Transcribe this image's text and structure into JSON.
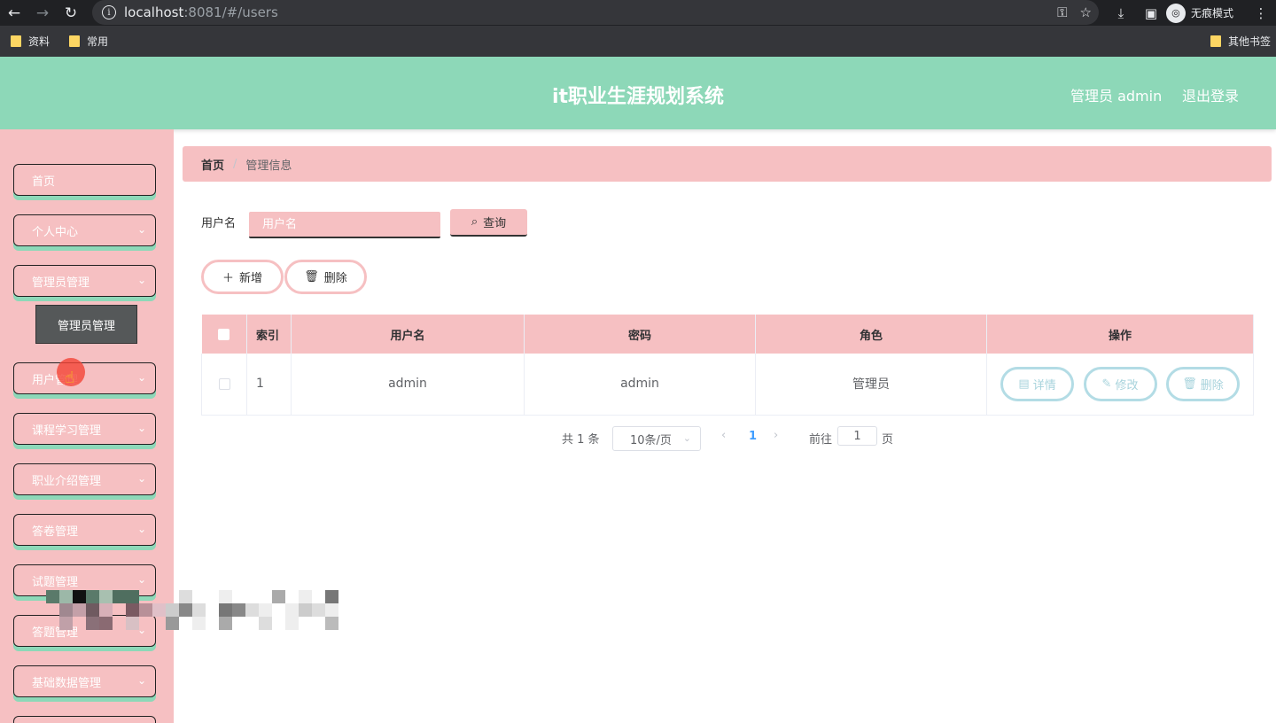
{
  "browser": {
    "url_host": "localhost",
    "url_rest": ":8081/#/users",
    "incognito_label": "无痕模式",
    "bookmarks": [
      "资料",
      "常用"
    ],
    "other_bookmarks": "其他书签"
  },
  "header": {
    "title": "it职业生涯规划系统",
    "user": "管理员 admin",
    "logout": "退出登录"
  },
  "sidebar": {
    "items": [
      {
        "label": "首页"
      },
      {
        "label": "个人中心"
      },
      {
        "label": "管理员管理"
      },
      {
        "label": "用户管理"
      },
      {
        "label": "课程学习管理"
      },
      {
        "label": "职业介绍管理"
      },
      {
        "label": "答卷管理"
      },
      {
        "label": "试题管理"
      },
      {
        "label": "答题管理"
      },
      {
        "label": "基础数据管理"
      }
    ],
    "tooltip": "管理员管理"
  },
  "breadcrumb": {
    "home": "首页",
    "separator": "/",
    "current": "管理信息"
  },
  "search": {
    "label": "用户名",
    "placeholder": "用户名",
    "query_button": "查询"
  },
  "actions": {
    "add": "新增",
    "delete": "删除"
  },
  "table": {
    "columns": [
      "索引",
      "用户名",
      "密码",
      "角色",
      "操作"
    ],
    "rows": [
      {
        "index": "1",
        "username": "admin",
        "password": "admin",
        "role": "管理员"
      }
    ],
    "row_actions": {
      "detail": "详情",
      "edit": "修改",
      "delete": "删除"
    }
  },
  "pagination": {
    "total": "共 1 条",
    "page_size": "10条/页",
    "current_page": "1",
    "goto": "前往",
    "jump_value": "1",
    "page_suffix": "页"
  },
  "colors": {
    "header_bg": "#8dd8b8",
    "sidebar_bg": "#f6c0c2",
    "op_button_border": "#b3dce5"
  }
}
